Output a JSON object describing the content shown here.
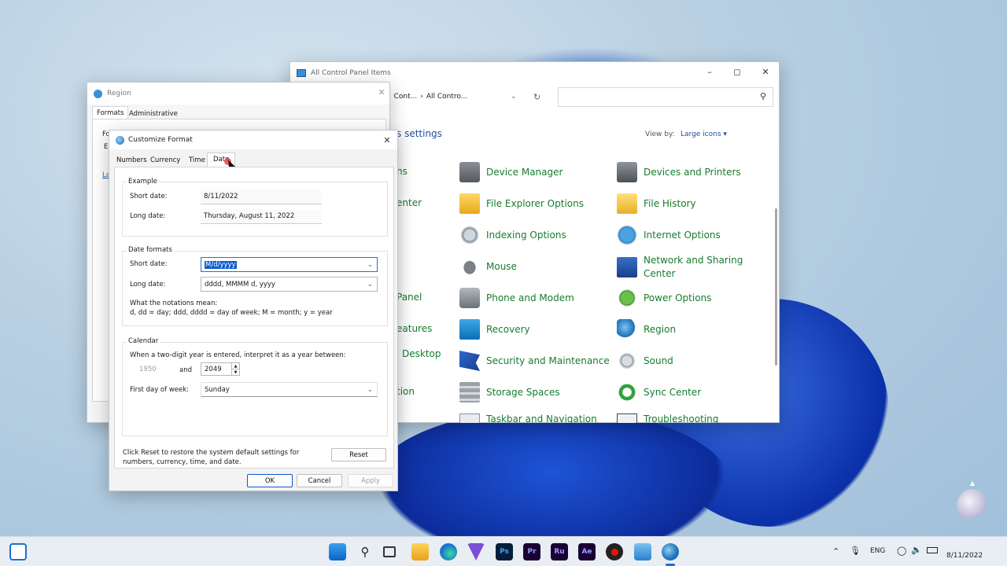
{
  "control_panel": {
    "title": "All Control Panel Items",
    "breadcrumb": [
      "Cont...",
      "All Contro..."
    ],
    "heading_fragment": "s settings",
    "view_by_label": "View by:",
    "view_by_value": "Large icons",
    "left_fragments": [
      "ns",
      "enter",
      "Panel",
      "eatures",
      "Desktop",
      "tion"
    ],
    "items": [
      {
        "label": "Device Manager",
        "icon": "device-manager-icon"
      },
      {
        "label": "Devices and Printers",
        "icon": "printer-icon"
      },
      {
        "label": "File Explorer Options",
        "icon": "folder-options-icon"
      },
      {
        "label": "File History",
        "icon": "file-history-icon"
      },
      {
        "label": "Indexing Options",
        "icon": "indexing-icon"
      },
      {
        "label": "Internet Options",
        "icon": "internet-options-icon"
      },
      {
        "label": "Mouse",
        "icon": "mouse-icon"
      },
      {
        "label": "Network and Sharing Center",
        "icon": "network-icon"
      },
      {
        "label": "Phone and Modem",
        "icon": "phone-icon"
      },
      {
        "label": "Power Options",
        "icon": "power-icon"
      },
      {
        "label": "Recovery",
        "icon": "recovery-icon"
      },
      {
        "label": "Region",
        "icon": "region-globe-icon"
      },
      {
        "label": "Security and Maintenance",
        "icon": "security-flag-icon"
      },
      {
        "label": "Sound",
        "icon": "speaker-icon"
      },
      {
        "label": "Storage Spaces",
        "icon": "storage-icon"
      },
      {
        "label": "Sync Center",
        "icon": "sync-icon"
      },
      {
        "label": "Taskbar and Navigation",
        "icon": "taskbar-icon"
      },
      {
        "label": "Troubleshooting",
        "icon": "troubleshoot-icon"
      }
    ]
  },
  "region": {
    "title": "Region",
    "tabs": [
      "Formats",
      "Administrative"
    ],
    "left_fragments": [
      "Fo",
      "Er",
      "La"
    ]
  },
  "customize": {
    "title": "Customize Format",
    "tabs": [
      "Numbers",
      "Currency",
      "Time",
      "Date"
    ],
    "example_title": "Example",
    "short_date_label": "Short date:",
    "short_date_value": "8/11/2022",
    "long_date_label": "Long date:",
    "long_date_value": "Thursday, August 11, 2022",
    "formats_title": "Date formats",
    "short_format": "M/d/yyyy",
    "long_format": "dddd, MMMM d, yyyy",
    "notation_title": "What the notations mean:",
    "notation_text": "d, dd = day;  ddd, dddd = day of week;  M = month;  y = year",
    "calendar_title": "Calendar",
    "two_digit_text": "When a two-digit year is entered, interpret it as a year between:",
    "year_from": "1950",
    "and_label": "and",
    "year_to": "2049",
    "first_day_label": "First day of week:",
    "first_day_value": "Sunday",
    "reset_text": "Click Reset to restore the system default settings for numbers, currency, time, and date.",
    "reset_button": "Reset",
    "ok": "OK",
    "cancel": "Cancel",
    "apply": "Apply"
  },
  "taskbar": {
    "apps": [
      "Ps",
      "Pr",
      "Ru",
      "Ae"
    ],
    "lang": "ENG",
    "date": "8/11/2022"
  }
}
